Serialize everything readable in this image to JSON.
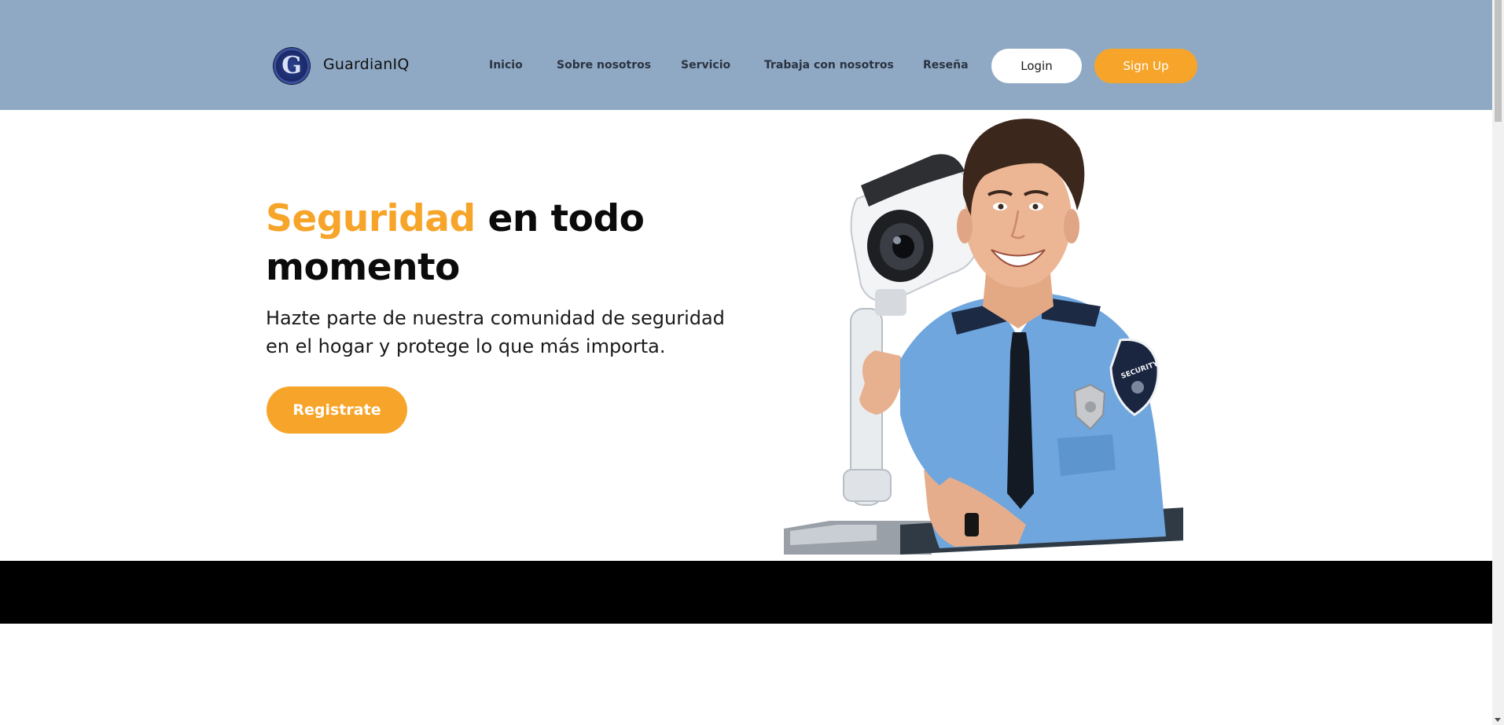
{
  "header": {
    "brand": "GuardianIQ",
    "logo_letter": "G",
    "nav": [
      "Inicio",
      "Sobre nosotros",
      "Servicio",
      "Trabaja con nosotros",
      "Reseña"
    ],
    "login_label": "Login",
    "signup_label": "Sign Up"
  },
  "hero": {
    "title_accent": "Seguridad",
    "title_rest": " en todo momento",
    "subtitle": "Hazte parte de nuestra comunidad de seguridad en el hogar y protege lo que más importa.",
    "cta_label": "Registrate",
    "image_badge": "SECURITY"
  },
  "colors": {
    "header_bg": "#8fa9c5",
    "accent": "#f7a52a",
    "band": "#000000"
  }
}
